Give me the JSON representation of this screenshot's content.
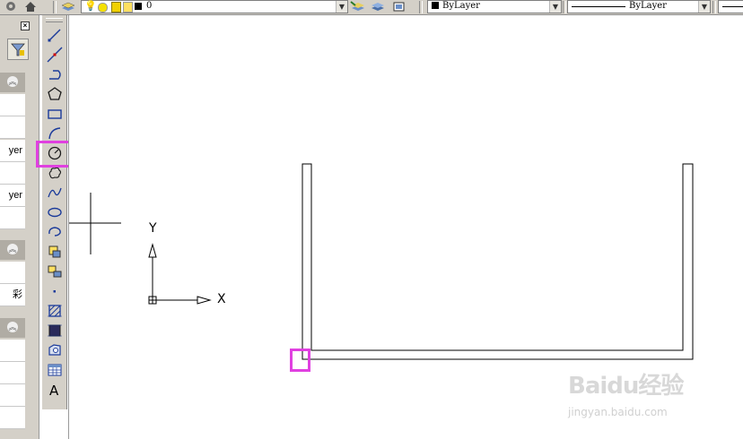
{
  "toolbar": {
    "layer_value": "0",
    "color_value": "ByLayer",
    "linetype_value": "ByLayer"
  },
  "palette": {
    "rows": [
      "yer",
      "yer",
      "彩"
    ]
  },
  "draw_tools": [
    "line-icon",
    "construction-line-icon",
    "polyline-icon",
    "polygon-icon",
    "rectangle-icon",
    "arc-icon",
    "circle-icon",
    "revision-cloud-icon",
    "spline-icon",
    "ellipse-icon",
    "ellipse-arc-icon",
    "insert-block-icon",
    "make-block-icon",
    "point-icon",
    "hatch-icon",
    "gradient-icon",
    "region-icon",
    "table-icon",
    "multiline-text-icon"
  ],
  "ucs": {
    "x_label": "X",
    "y_label": "Y"
  },
  "watermark": {
    "logo": "Baidu经验",
    "url": "jingyan.baidu.com"
  },
  "colors": {
    "highlight": "#e040e0",
    "toolbar_bg": "#d4d0c8"
  }
}
